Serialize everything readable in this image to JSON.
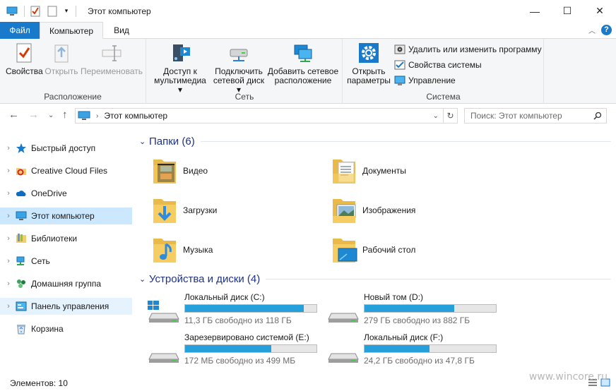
{
  "window": {
    "title": "Этот компьютер"
  },
  "tabs": {
    "file": "Файл",
    "computer": "Компьютер",
    "view": "Вид"
  },
  "ribbon": {
    "location": {
      "label": "Расположение",
      "properties": "Свойства",
      "open": "Открыть",
      "rename": "Переименовать"
    },
    "network": {
      "label": "Сеть",
      "media_l1": "Доступ к",
      "media_l2": "мультимедиа",
      "map_l1": "Подключить",
      "map_l2": "сетевой диск",
      "add_l1": "Добавить сетевое",
      "add_l2": "расположение"
    },
    "system": {
      "label": "Система",
      "params_l1": "Открыть",
      "params_l2": "параметры",
      "uninstall": "Удалить или изменить программу",
      "sys_props": "Свойства системы",
      "manage": "Управление"
    }
  },
  "address": {
    "crumb": "Этот компьютер",
    "search_placeholder": "Поиск: Этот компьютер"
  },
  "nav": {
    "items": [
      {
        "label": "Быстрый доступ"
      },
      {
        "label": "Creative Cloud Files"
      },
      {
        "label": "OneDrive"
      },
      {
        "label": "Этот компьютер"
      },
      {
        "label": "Библиотеки"
      },
      {
        "label": "Сеть"
      },
      {
        "label": "Домашняя группа"
      },
      {
        "label": "Панель управления"
      },
      {
        "label": "Корзина"
      }
    ]
  },
  "folders": {
    "title": "Папки (6)",
    "items": [
      {
        "label": "Видео",
        "icon": "video-folder-icon"
      },
      {
        "label": "Документы",
        "icon": "documents-folder-icon"
      },
      {
        "label": "Загрузки",
        "icon": "downloads-folder-icon"
      },
      {
        "label": "Изображения",
        "icon": "pictures-folder-icon"
      },
      {
        "label": "Музыка",
        "icon": "music-folder-icon"
      },
      {
        "label": "Рабочий стол",
        "icon": "desktop-folder-icon"
      }
    ]
  },
  "drives": {
    "title": "Устройства и диски (4)",
    "items": [
      {
        "name": "Локальный диск (C:)",
        "free": "11,3 ГБ свободно из 118 ГБ",
        "used_fraction": 0.904,
        "windows": true
      },
      {
        "name": "Новый том (D:)",
        "free": "279 ГБ свободно из 882 ГБ",
        "used_fraction": 0.684,
        "windows": false
      },
      {
        "name": "Зарезервировано системой (E:)",
        "free": "172 МБ свободно из 499 МБ",
        "used_fraction": 0.655,
        "windows": false
      },
      {
        "name": "Локальный диск (F:)",
        "free": "24,2 ГБ свободно из 47,8 ГБ",
        "used_fraction": 0.494,
        "windows": false
      }
    ]
  },
  "status": {
    "count": "Элементов: 10"
  },
  "watermark": "www.wincore.ru",
  "colors": {
    "accent": "#1979ca",
    "drive_bar": "#26a0da",
    "section_title": "#1e3287",
    "selected": "#cce8ff"
  }
}
